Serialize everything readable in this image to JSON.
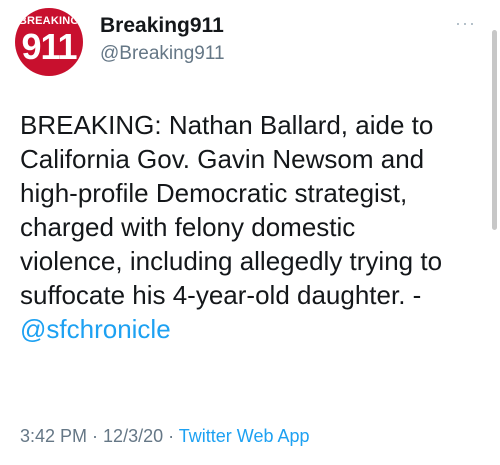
{
  "account": {
    "avatar_top_text": "BREAKING",
    "avatar_number": "911",
    "display_name": "Breaking911",
    "handle": "@Breaking911",
    "more_icon": "ellipsis-icon"
  },
  "tweet": {
    "lines": [
      "BREAKING: Nathan Ballard, aide to",
      "California Gov. Gavin Newsom and",
      "high-profile Democratic strategist,",
      "charged with felony domestic",
      "violence, including allegedly trying to",
      "suffocate his 4-year-old daughter. -"
    ],
    "mention": "@sfchronicle"
  },
  "meta": {
    "time": "3:42 PM",
    "separator1": " · ",
    "date": "12/3/20",
    "separator2": " · ",
    "source": "Twitter Web App"
  },
  "colors": {
    "avatar_red": "#c8102e",
    "link_blue": "#1da1f2",
    "secondary_gray": "#657786"
  }
}
